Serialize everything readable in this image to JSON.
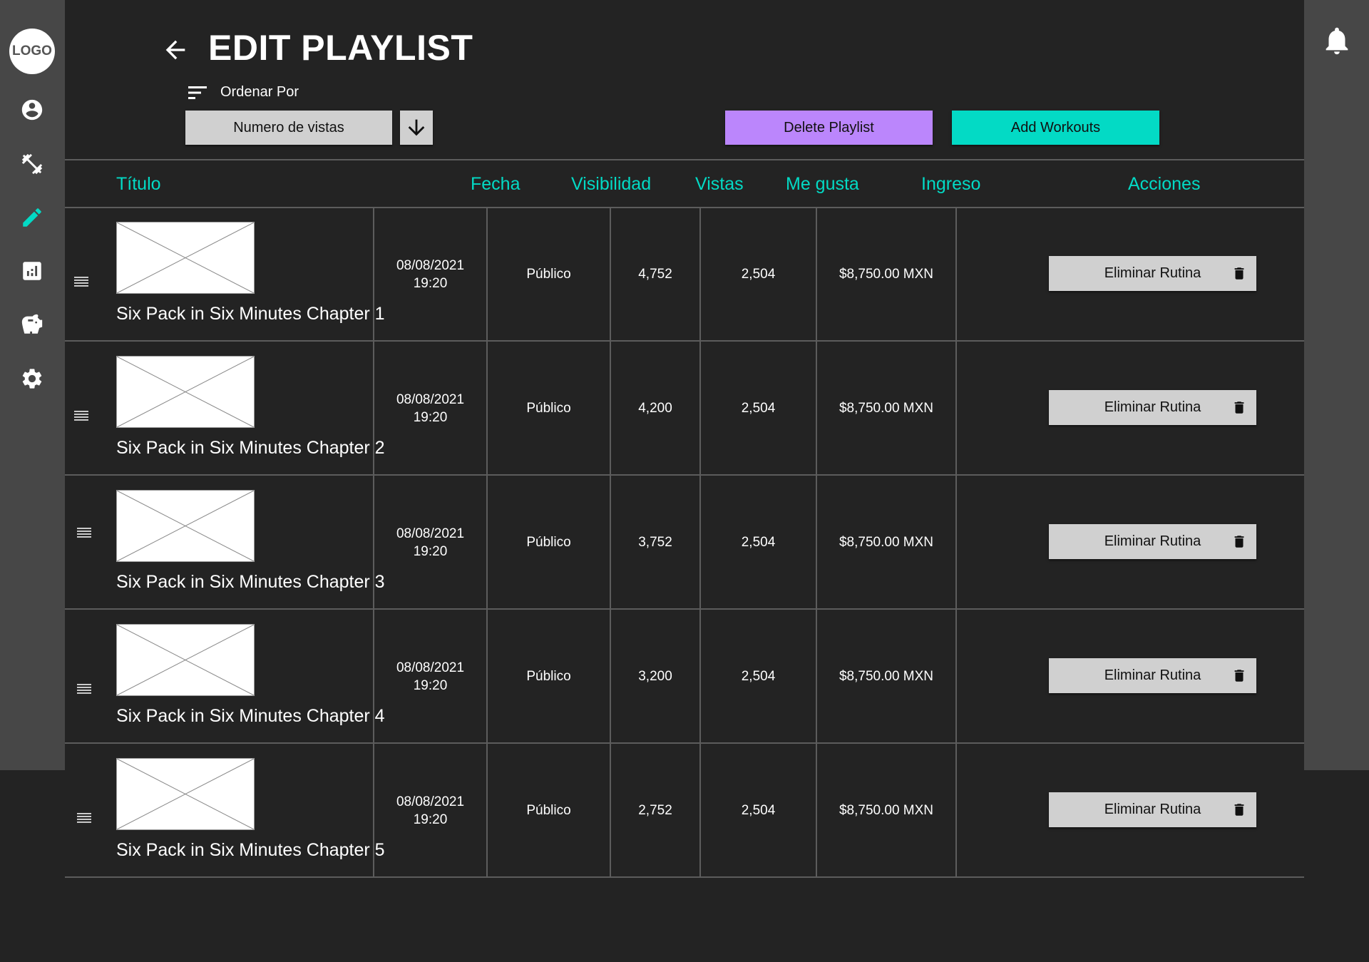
{
  "sidebar": {
    "logo": "LOGO",
    "icons": [
      "account-circle-icon",
      "dumbbell-icon",
      "edit-pencil-icon",
      "analytics-icon",
      "savings-piggy-icon",
      "settings-gear-icon"
    ],
    "active_icon": "edit-pencil-icon",
    "active_color": "#03dac5"
  },
  "header": {
    "title": "EDIT PLAYLIST",
    "sort_label": "Ordenar Por",
    "sort_value": "Numero de vistas",
    "delete_button": "Delete Playlist",
    "add_button": "Add Workouts"
  },
  "colors": {
    "accent_teal": "#03dac5",
    "accent_purple": "#bb86fc",
    "background": "#232323",
    "sidebar": "#474747"
  },
  "table": {
    "columns": [
      "Título",
      "Fecha",
      "Visibilidad",
      "Vistas",
      "Me gusta",
      "Ingreso",
      "Acciones"
    ],
    "rows": [
      {
        "title": "Six Pack in Six Minutes Chapter 1",
        "date": "08/08/2021",
        "time": "19:20",
        "visibility": "Público",
        "views": "4,752",
        "likes": "2,504",
        "income": "$8,750.00 MXN",
        "action": "Eliminar Rutina"
      },
      {
        "title": "Six Pack in Six Minutes Chapter 2",
        "date": "08/08/2021",
        "time": "19:20",
        "visibility": "Público",
        "views": "4,200",
        "likes": "2,504",
        "income": "$8,750.00 MXN",
        "action": "Eliminar Rutina"
      },
      {
        "title": "Six Pack in Six Minutes Chapter 3",
        "date": "08/08/2021",
        "time": "19:20",
        "visibility": "Público",
        "views": "3,752",
        "likes": "2,504",
        "income": "$8,750.00 MXN",
        "action": "Eliminar Rutina"
      },
      {
        "title": "Six Pack in Six Minutes Chapter 4",
        "date": "08/08/2021",
        "time": "19:20",
        "visibility": "Público",
        "views": "3,200",
        "likes": "2,504",
        "income": "$8,750.00 MXN",
        "action": "Eliminar Rutina"
      },
      {
        "title": "Six Pack in Six Minutes Chapter 5",
        "date": "08/08/2021",
        "time": "19:20",
        "visibility": "Público",
        "views": "2,752",
        "likes": "2,504",
        "income": "$8,750.00 MXN",
        "action": "Eliminar Rutina"
      }
    ]
  }
}
